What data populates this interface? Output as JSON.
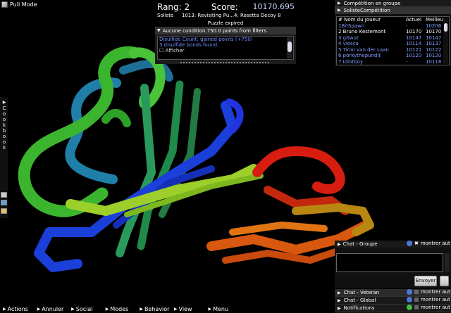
{
  "pull_mode": {
    "label": "Pull Mode"
  },
  "score_panel": {
    "rank": "Rang: 2",
    "score_label": "Score:",
    "score_value": "10170.695",
    "mode": "Soliste",
    "puzzle": "1013: Revisiting Pu...4: Rosetta Decoy 8",
    "status": "Puzzle expired",
    "conditions_header": "Aucune condition.750.0 points from filters",
    "conditions": [
      "Disulfide Count: gained points (+750)",
      "3 disulfide bonds found.",
      "Afficher"
    ]
  },
  "competition": {
    "group_label": "Compétition en groupe",
    "solo_label": "SolisteCompétition",
    "columns": [
      "# Nom du Joueur",
      "Actuel",
      "Meilleur"
    ],
    "rows": [
      {
        "name": "1BitSpawn",
        "current": "-",
        "best": "10206",
        "highlight": true
      },
      {
        "name": "2 Bruno Kestemont",
        "current": "10170",
        "best": "10170",
        "highlight": false
      },
      {
        "name": "3 gitwut",
        "current": "10147",
        "best": "10147",
        "highlight": true
      },
      {
        "name": "4 viosca",
        "current": "10114",
        "best": "10137",
        "highlight": true
      },
      {
        "name": "5 Timo van der Laan",
        "current": "10121",
        "best": "10122",
        "highlight": true
      },
      {
        "name": "6 porkythepundit",
        "current": "10120",
        "best": "10120",
        "highlight": true
      },
      {
        "name": "7 Idiotboy",
        "current": "-",
        "best": "10118",
        "highlight": true
      }
    ]
  },
  "cookbook": {
    "letters": [
      "C",
      "o",
      "o",
      "k",
      "b",
      "o",
      "o",
      "k"
    ]
  },
  "chat_group": {
    "title": "Chat - Groupe",
    "show_auto": "montrer aut",
    "send": "Envoyer"
  },
  "chat_rows": [
    {
      "title": "Chat - Veteran",
      "show_auto": "montrer aut"
    },
    {
      "title": "Chat - Global",
      "show_auto": "montrer aut"
    },
    {
      "title": "Notifications",
      "show_auto": "montrer aut"
    }
  ],
  "menu": [
    "Actions",
    "Annuler",
    "Social",
    "Modes",
    "Behavior",
    "View",
    "Menu"
  ],
  "colors": {
    "score_blue": "#c9d6ff",
    "list_blue": "#7f9dff",
    "panel": "#1c1c1c"
  }
}
